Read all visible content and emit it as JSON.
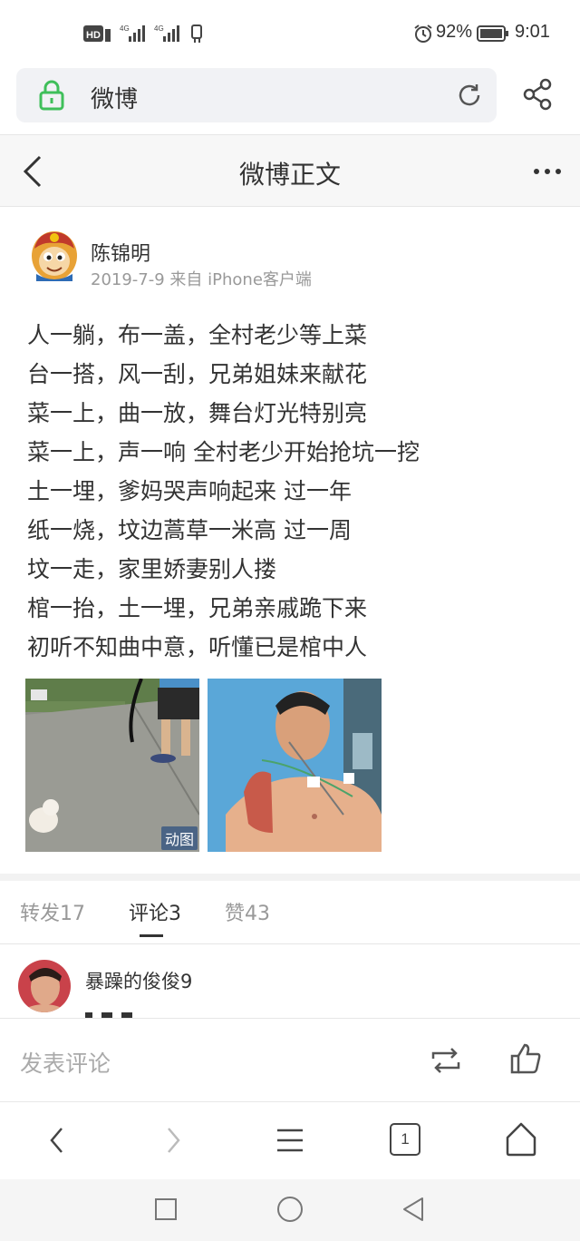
{
  "status_bar": {
    "left_indicators": "HD 4G 4G",
    "battery": "92%",
    "time": "9:01"
  },
  "url_bar": {
    "site": "微博"
  },
  "header": {
    "title": "微博正文"
  },
  "post": {
    "author": "陈锦明",
    "meta": "2019-7-9  来自 iPhone客户端",
    "lines": [
      "人一躺，布一盖，全村老少等上菜",
      "台一搭，风一刮，兄弟姐妹来献花",
      "菜一上，曲一放，舞台灯光特别亮",
      "菜一上，声一响 全村老少开始抢坑一挖",
      "土一埋，爹妈哭声响起来 过一年",
      "纸一烧，坟边蒿草一米高 过一周",
      "坟一走，家里娇妻别人搂",
      "棺一抬，土一埋，兄弟亲戚跪下来",
      "初听不知曲中意，听懂已是棺中人"
    ],
    "gif_badge": "动图"
  },
  "tabs": [
    {
      "label": "转发17"
    },
    {
      "label": "评论3"
    },
    {
      "label": "赞43"
    }
  ],
  "comment": {
    "user": "暴躁的俊俊9"
  },
  "comment_bar": {
    "placeholder": "发表评论"
  },
  "browser_toolbar": {
    "tab_count": "1"
  },
  "colors": {
    "lock_green": "#3fbf5a",
    "text_primary": "#333333",
    "text_muted": "#999999"
  }
}
